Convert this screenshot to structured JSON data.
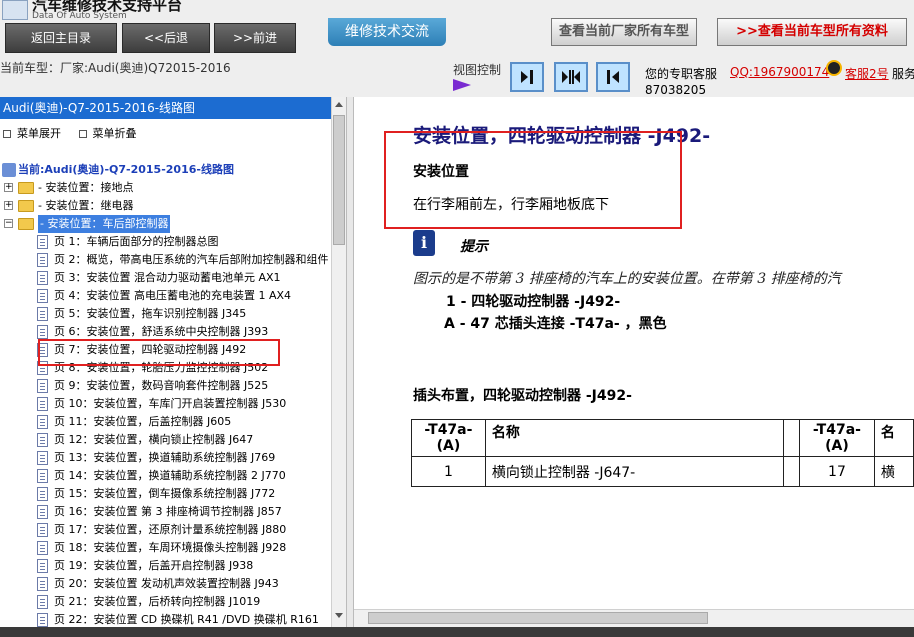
{
  "header": {
    "app_title": "汽车维修技术支持平台",
    "app_subtitle": "Data Of Auto System",
    "nav": {
      "home": "返回主目录",
      "back": "<<后退",
      "forward": ">>前进"
    },
    "forum": "维修技术交流",
    "factory_models": "查看当前厂家所有车型",
    "all_data": ">>查看当前车型所有资料"
  },
  "infobar": {
    "current_model": "当前车型：厂家:Audi(奥迪)Q72015-2016",
    "view_control": "视图控制",
    "support_label": "您的专职客服",
    "qq": "QQ:1967900174",
    "kefu": "客服2号",
    "service": "服务",
    "phone": "87038205"
  },
  "tree": {
    "header": "Audi(奥迪)-Q7-2015-2016-线路图",
    "expand_all": "菜单展开",
    "collapse_all": "菜单折叠",
    "root": "当前:Audi(奥迪)-Q7-2015-2016-线路图",
    "folders": [
      "- 安装位置：接地点",
      "- 安装位置：继电器",
      "- 安装位置：车后部控制器"
    ],
    "pages": [
      "页 1：车辆后面部分的控制器总图",
      "页 2：概览，带高电压系统的汽车后部附加控制器和组件",
      "页 3：安装位置 混合动力驱动蓄电池单元 AX1",
      "页 4：安装位置 高电压蓄电池的充电装置 1 AX4",
      "页 5：安装位置，拖车识别控制器 J345",
      "页 6：安装位置，舒适系统中央控制器 J393",
      "页 7：安装位置，四轮驱动控制器 J492",
      "页 8：安装位置，轮胎压力监控控制器 J502",
      "页 9：安装位置，数码音响套件控制器 J525",
      "页 10：安装位置，车库门开启装置控制器 J530",
      "页 11：安装位置，后盖控制器 J605",
      "页 12：安装位置，横向锁止控制器 J647",
      "页 13：安装位置，换道辅助系统控制器 J769",
      "页 14：安装位置，换道辅助系统控制器 2 J770",
      "页 15：安装位置，倒车摄像系统控制器 J772",
      "页 16：安装位置 第 3 排座椅调节控制器 J857",
      "页 17：安装位置，还原剂计量系统控制器 J880",
      "页 18：安装位置，车周环境摄像头控制器 J928",
      "页 19：安装位置，后盖开启控制器 J938",
      "页 20：安装位置 发动机声效装置控制器 J943",
      "页 21：安装位置，后桥转向控制器 J1019",
      "页 22：安装位置 CD 换碟机 R41 /DVD 换碟机 R161"
    ],
    "selected_page_index": 6
  },
  "document": {
    "title": "安装位置，四轮驱动控制器 -J492-",
    "section_title": "安装位置",
    "section_text": "在行李厢前左，行李厢地板底下",
    "hint_title": "提示",
    "hint_text": "图示的是不带第 3 排座椅的汽车上的安装位置。在带第 3 排座椅的汽",
    "legend": [
      "1 - 四轮驱动控制器 -J492-",
      "A - 47 芯插头连接 -T47a- ，黑色"
    ],
    "table_title": "插头布置，四轮驱动控制器 -J492-",
    "table": {
      "headers": [
        "-T47a-\n(A)",
        "名称",
        "",
        "-T47a-\n(A)",
        "名"
      ],
      "rows": [
        [
          "1",
          "横向锁止控制器 -J647-",
          "",
          "17",
          "横"
        ]
      ]
    }
  }
}
